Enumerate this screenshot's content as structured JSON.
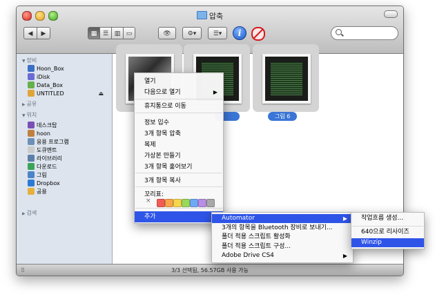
{
  "window": {
    "title": "압축",
    "status": "3/3 선택됨, 56.57GB 사용 가능"
  },
  "sidebar": {
    "sections": [
      {
        "label": "장비",
        "items": [
          {
            "label": "Hoon_Box",
            "icon": "hdd-icon"
          },
          {
            "label": "iDisk",
            "icon": "idisk-icon"
          },
          {
            "label": "Data_Box",
            "icon": "disk-icon"
          },
          {
            "label": "UNTITLED",
            "icon": "usb-icon"
          }
        ]
      },
      {
        "label": "공유",
        "items": []
      },
      {
        "label": "위치",
        "items": [
          {
            "label": "데스크탑",
            "icon": "desktop-icon"
          },
          {
            "label": "hoon",
            "icon": "home-icon"
          },
          {
            "label": "응용 프로그램",
            "icon": "applications-icon"
          },
          {
            "label": "도큐멘트",
            "icon": "documents-icon"
          },
          {
            "label": "라이브러리",
            "icon": "library-icon"
          },
          {
            "label": "다운로드",
            "icon": "downloads-icon"
          },
          {
            "label": "그림",
            "icon": "pictures-icon"
          },
          {
            "label": "Dropbox",
            "icon": "dropbox-icon"
          },
          {
            "label": "공용",
            "icon": "public-icon"
          }
        ]
      },
      {
        "label": "검색",
        "items": []
      }
    ]
  },
  "files": [
    {
      "label": "",
      "kind": "crowd"
    },
    {
      "label": "",
      "kind": "screen"
    },
    {
      "label": "그림 6",
      "kind": "screen"
    }
  ],
  "context_menu": {
    "items": [
      {
        "label": "열기"
      },
      {
        "label": "다음으로 열기",
        "submenu": true
      },
      {
        "label": "휴지통으로 이동"
      },
      {
        "label": "정보 입수"
      },
      {
        "label": "3개 항목 압축"
      },
      {
        "label": "복제"
      },
      {
        "label": "가상본 만들기"
      },
      {
        "label": "3개 항목 훑어보기"
      },
      {
        "label": "3개 항목 복사"
      },
      {
        "label": "꼬리표:"
      },
      {
        "label": "추가",
        "submenu": true
      }
    ],
    "tag_clear": "×",
    "tag_colors": [
      "#f25c54",
      "#f7a64a",
      "#f5d64e",
      "#9ad859",
      "#6fa8f5",
      "#b98ee6",
      "#a8a8a8"
    ]
  },
  "services_menu": {
    "items": [
      {
        "label": "Automator",
        "submenu": true
      },
      {
        "label": "3개의 항목을 Bluetooth 장비로 보내기..."
      },
      {
        "label": "폴더 적용 스크립트 활성화"
      },
      {
        "label": "폴더 적용 스크립트 구성..."
      },
      {
        "label": "Adobe Drive CS4",
        "submenu": true
      }
    ]
  },
  "automator_menu": {
    "items": [
      {
        "label": "작업흐름 생성..."
      },
      {
        "label": "640으로 리사이즈"
      },
      {
        "label": "Winzip"
      }
    ]
  }
}
